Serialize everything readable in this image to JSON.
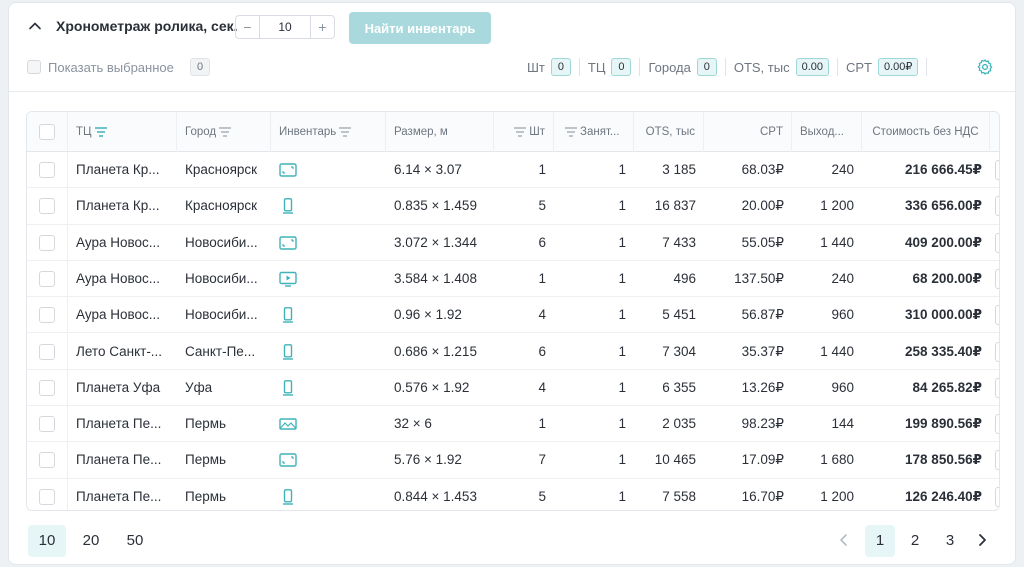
{
  "controls": {
    "duration_label": "Хронометраж ролика, сек.",
    "duration_value": "10",
    "minus": "−",
    "plus": "+",
    "find_button": "Найти инвентарь",
    "show_selected_label": "Показать выбранное",
    "show_selected_count": "0"
  },
  "stats": [
    {
      "label": "Шт",
      "value": "0"
    },
    {
      "label": "ТЦ",
      "value": "0"
    },
    {
      "label": "Города",
      "value": "0"
    },
    {
      "label": "OTS, тыс",
      "value": "0.00"
    },
    {
      "label": "CPT",
      "value": "0.00₽"
    }
  ],
  "table": {
    "headers": {
      "mall": "ТЦ",
      "city": "Город",
      "inventory": "Инвентарь",
      "size": "Размер, м",
      "qty": "Шт",
      "occupied": "Занят...",
      "ots": "OTS, тыс",
      "cpt": "CPT",
      "outputs": "Выход...",
      "cost": "Стоимость без НДС"
    },
    "rows": [
      {
        "mall": "Планета Кр...",
        "city": "Красноярск",
        "icon": "screen-icon",
        "size": "6.14 × 3.07",
        "qty": "1",
        "occupied": "1",
        "ots": "3 185",
        "cpt": "68.03₽",
        "outputs": "240",
        "cost": "216 666.45₽"
      },
      {
        "mall": "Планета Кр...",
        "city": "Красноярск",
        "icon": "vertical-screen-icon",
        "size": "0.835 × 1.459",
        "qty": "5",
        "occupied": "1",
        "ots": "16 837",
        "cpt": "20.00₽",
        "outputs": "1 200",
        "cost": "336 656.00₽"
      },
      {
        "mall": "Аура Новос...",
        "city": "Новосиби...",
        "icon": "screen-icon",
        "size": "3.072 × 1.344",
        "qty": "6",
        "occupied": "1",
        "ots": "7 433",
        "cpt": "55.05₽",
        "outputs": "1 440",
        "cost": "409 200.00₽"
      },
      {
        "mall": "Аура Новос...",
        "city": "Новосиби...",
        "icon": "video-screen-icon",
        "size": "3.584 × 1.408",
        "qty": "1",
        "occupied": "1",
        "ots": "496",
        "cpt": "137.50₽",
        "outputs": "240",
        "cost": "68 200.00₽"
      },
      {
        "mall": "Аура Новос...",
        "city": "Новосиби...",
        "icon": "vertical-screen-icon",
        "size": "0.96 × 1.92",
        "qty": "4",
        "occupied": "1",
        "ots": "5 451",
        "cpt": "56.87₽",
        "outputs": "960",
        "cost": "310 000.00₽"
      },
      {
        "mall": "Лето Санкт-...",
        "city": "Санкт-Пе...",
        "icon": "vertical-screen-icon",
        "size": "0.686 × 1.215",
        "qty": "6",
        "occupied": "1",
        "ots": "7 304",
        "cpt": "35.37₽",
        "outputs": "1 440",
        "cost": "258 335.40₽"
      },
      {
        "mall": "Планета Уфа",
        "city": "Уфа",
        "icon": "vertical-screen-icon",
        "size": "0.576 × 1.92",
        "qty": "4",
        "occupied": "1",
        "ots": "6 355",
        "cpt": "13.26₽",
        "outputs": "960",
        "cost": "84 265.82₽"
      },
      {
        "mall": "Планета Пе...",
        "city": "Пермь",
        "icon": "banner-icon",
        "size": "32 × 6",
        "qty": "1",
        "occupied": "1",
        "ots": "2 035",
        "cpt": "98.23₽",
        "outputs": "144",
        "cost": "199 890.56₽"
      },
      {
        "mall": "Планета Пе...",
        "city": "Пермь",
        "icon": "screen-icon",
        "size": "5.76 × 1.92",
        "qty": "7",
        "occupied": "1",
        "ots": "10 465",
        "cpt": "17.09₽",
        "outputs": "1 680",
        "cost": "178 850.56₽"
      },
      {
        "mall": "Планета Пе...",
        "city": "Пермь",
        "icon": "vertical-screen-icon",
        "size": "0.844 × 1.453",
        "qty": "5",
        "occupied": "1",
        "ots": "7 558",
        "cpt": "16.70₽",
        "outputs": "1 200",
        "cost": "126 246.40₽"
      }
    ]
  },
  "pagination": {
    "sizes": [
      "10",
      "20",
      "50"
    ],
    "pages": [
      "1",
      "2",
      "3"
    ],
    "active_page": "1",
    "active_size": "10"
  },
  "colors": {
    "accent": "#3fb3b8",
    "accent_light": "#e6f6f6",
    "button_disabled": "#a9d9dc"
  }
}
